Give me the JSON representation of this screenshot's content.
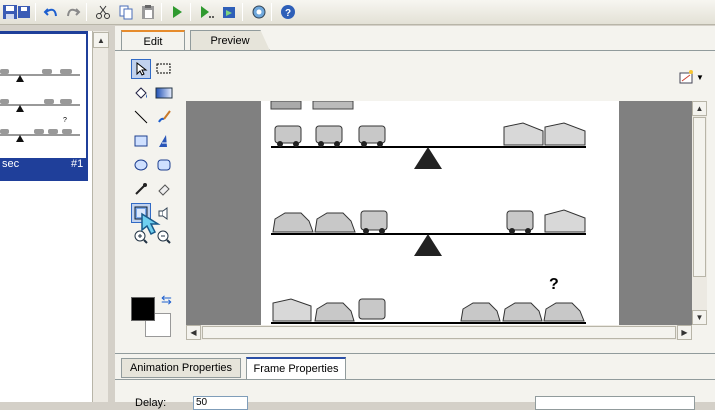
{
  "toolbar": {
    "buttons": [
      "save-icon",
      "undo-icon",
      "redo-icon",
      "cut-icon",
      "copy-icon",
      "paste-icon",
      "play-icon",
      "play-from-frame-icon",
      "export-icon",
      "view-icon",
      "help-icon"
    ]
  },
  "frames": {
    "time_label": "sec",
    "frame_number": "#1"
  },
  "tabs": {
    "edit": "Edit",
    "preview": "Preview"
  },
  "tools": [
    "select-arrow-icon",
    "marquee-select-icon",
    "paint-bucket-icon",
    "gradient-icon",
    "line-icon",
    "brush-icon",
    "rectangle-icon",
    "text-icon",
    "ellipse-icon",
    "rounded-rectangle-icon",
    "eyedropper-icon",
    "eraser-icon",
    "image-tool-icon",
    "sound-icon",
    "zoom-in-icon",
    "zoom-out-icon"
  ],
  "colors": {
    "foreground": "#000000",
    "background": "#ffffff",
    "accent": "#e68b2c",
    "selection": "#1f3f9a"
  },
  "stage": {
    "question_mark": "?"
  },
  "property_tabs": {
    "animation": "Animation Properties",
    "frame": "Frame Properties"
  },
  "frame_properties": {
    "delay_label": "Delay:",
    "delay_value": "50"
  }
}
